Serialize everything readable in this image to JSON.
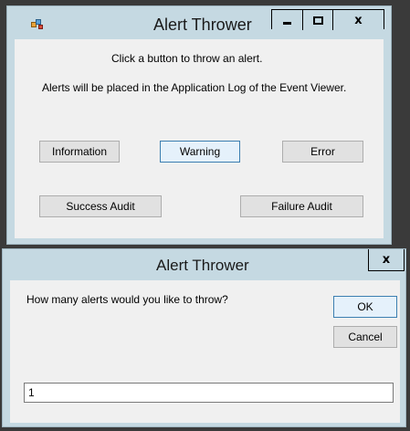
{
  "main_window": {
    "title": "Alert Thrower",
    "close_glyph": "x",
    "instruction_line1": "Click a button to throw an alert.",
    "instruction_line2": "Alerts will be placed in the Application Log of the Event Viewer.",
    "buttons": {
      "information": "Information",
      "warning": "Warning",
      "error": "Error",
      "success_audit": "Success Audit",
      "failure_audit": "Failure Audit"
    }
  },
  "dialog": {
    "title": "Alert Thrower",
    "close_glyph": "x",
    "prompt": "How many alerts would you like to throw?",
    "ok_label": "OK",
    "cancel_label": "Cancel",
    "input_value": "1"
  },
  "icons": {
    "app": "app-icon",
    "minimize": "minimize-icon",
    "maximize": "maximize-icon",
    "close": "close-icon"
  },
  "colors": {
    "frame": "#c5d9e2",
    "client": "#f0f0f0",
    "button": "#e1e1e1",
    "focus_border": "#3c7fb1"
  }
}
